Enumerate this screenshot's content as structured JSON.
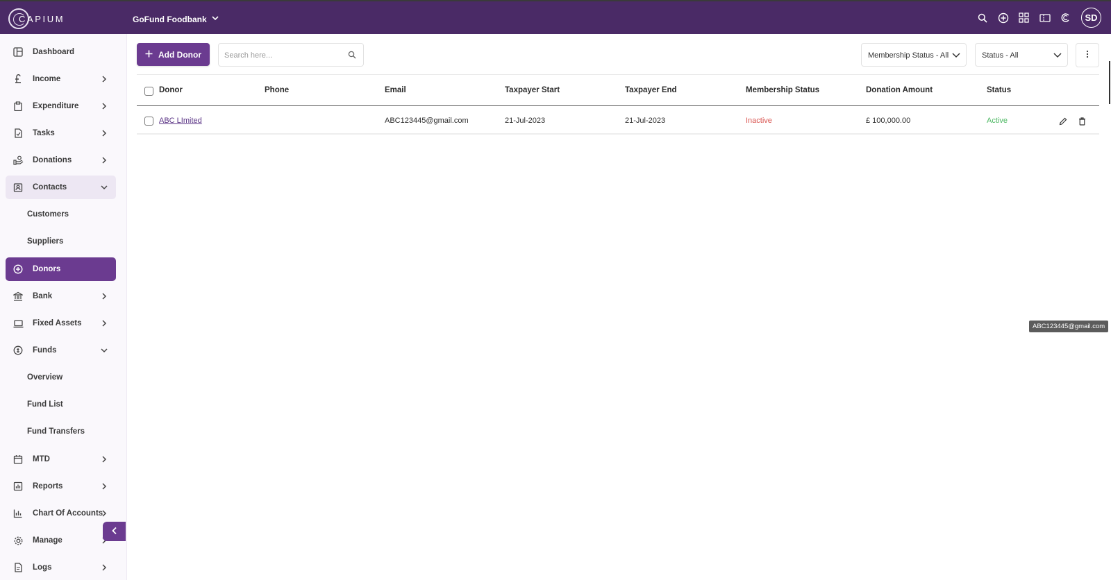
{
  "header": {
    "logo_text": "CAPIUM",
    "org_name": "GoFund Foodbank",
    "avatar_initials": "SD",
    "icons": [
      "search-icon",
      "add-circle-icon",
      "apps-grid-icon",
      "ticket-icon",
      "capium-icon"
    ]
  },
  "sidebar": {
    "items": [
      {
        "label": "Dashboard",
        "icon": "dashboard-icon"
      },
      {
        "label": "Income",
        "icon": "pound-icon"
      },
      {
        "label": "Expenditure",
        "icon": "clipboard-icon"
      },
      {
        "label": "Tasks",
        "icon": "task-icon"
      },
      {
        "label": "Donations",
        "icon": "donation-icon"
      },
      {
        "label": "Contacts",
        "icon": "contacts-icon"
      },
      {
        "label": "Customers"
      },
      {
        "label": "Suppliers"
      },
      {
        "label": "Donors",
        "icon": "add-circle-icon"
      },
      {
        "label": "Bank",
        "icon": "bank-icon"
      },
      {
        "label": "Fixed Assets",
        "icon": "laptop-icon"
      },
      {
        "label": "Funds",
        "icon": "funds-icon"
      },
      {
        "label": "Overview"
      },
      {
        "label": "Fund List"
      },
      {
        "label": "Fund Transfers"
      },
      {
        "label": "MTD",
        "icon": "calendar-icon"
      },
      {
        "label": "Reports",
        "icon": "report-icon"
      },
      {
        "label": "Chart Of Accounts",
        "icon": "chart-icon"
      },
      {
        "label": "Manage",
        "icon": "gear-icon"
      },
      {
        "label": "Logs",
        "icon": "log-icon"
      }
    ]
  },
  "toolbar": {
    "add_label": "Add Donor",
    "search_placeholder": "Search here...",
    "membership_filter": "Membership Status - All",
    "status_filter": "Status - All"
  },
  "table": {
    "columns": [
      "Donor",
      "Phone",
      "Email",
      "Taxpayer Start",
      "Taxpayer End",
      "Membership Status",
      "Donation Amount",
      "Status"
    ],
    "rows": [
      {
        "donor": "ABC LImited",
        "phone": "",
        "email": "ABC123445@gmail.com",
        "taxpayer_start": "21-Jul-2023",
        "taxpayer_end": "21-Jul-2023",
        "membership_status": "Inactive",
        "donation_amount": "£ 100,000.00",
        "status": "Active"
      }
    ]
  },
  "tooltip": "ABC123445@gmail.com",
  "colors": {
    "brand": "#4a2a66",
    "accent": "#6b3b90",
    "inactive": "#d9534f",
    "active": "#4cb862"
  }
}
